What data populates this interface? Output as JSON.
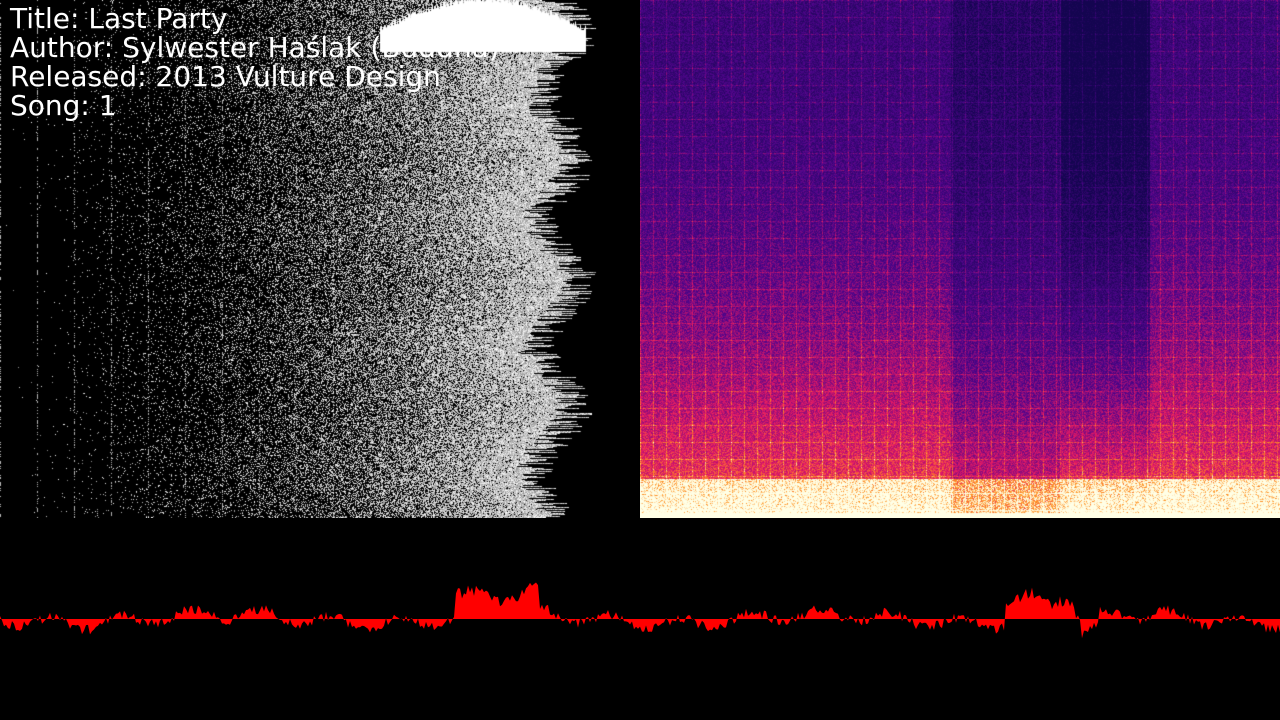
{
  "song_info": {
    "title_line": "Title: Last Party",
    "author_line": "Author: Sylwester Haślak (Buddha)",
    "released_line": "Released: 2013 Vulture Design",
    "song_line": "Song: 1"
  },
  "colors": {
    "background": "#000000",
    "text": "#ffffff",
    "waveform": "#ff0000",
    "spectrum_low": "#0a0a5a",
    "spectrum_mid": "#c0206a",
    "spectrum_high": "#ffd860"
  }
}
